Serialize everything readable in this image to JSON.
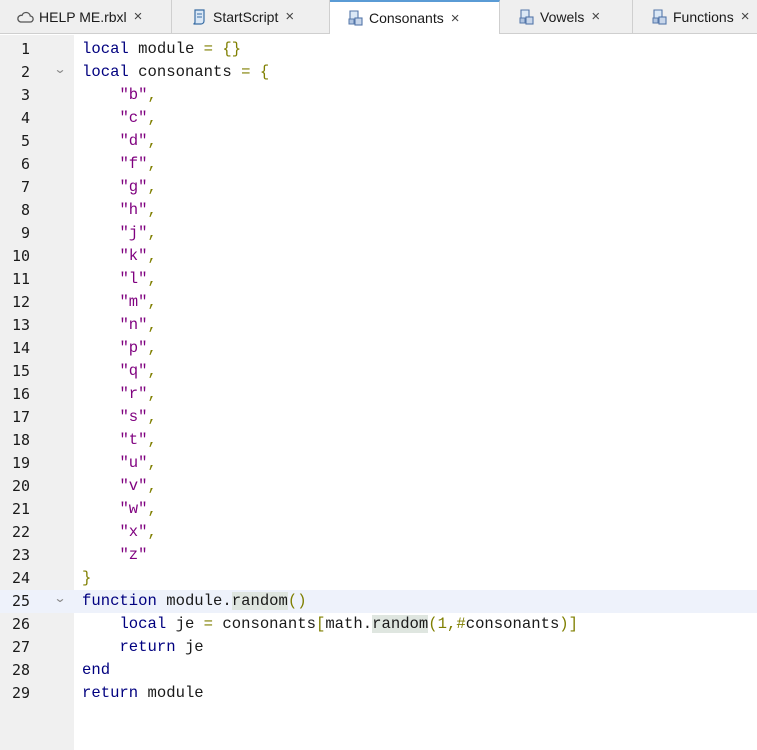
{
  "tabs": [
    {
      "label": "HELP ME.rbxl",
      "icon": "cloud-icon",
      "close": "×",
      "active": false
    },
    {
      "label": "StartScript",
      "icon": "script-icon",
      "close": "×",
      "active": false
    },
    {
      "label": "Consonants",
      "icon": "module-script-icon",
      "close": "×",
      "active": true
    },
    {
      "label": "Vowels",
      "icon": "module-script-icon",
      "close": "×",
      "active": false
    },
    {
      "label": "Functions",
      "icon": "module-script-icon",
      "close": "×",
      "active": false
    }
  ],
  "editor": {
    "current_line": 25,
    "fold_arrow": "⌄",
    "lines": [
      {
        "num": "1",
        "code": "local module = {}"
      },
      {
        "num": "2",
        "code": "local consonants = {",
        "fold": true
      },
      {
        "num": "3",
        "code": "    \"b\","
      },
      {
        "num": "4",
        "code": "    \"c\","
      },
      {
        "num": "5",
        "code": "    \"d\","
      },
      {
        "num": "6",
        "code": "    \"f\","
      },
      {
        "num": "7",
        "code": "    \"g\","
      },
      {
        "num": "8",
        "code": "    \"h\","
      },
      {
        "num": "9",
        "code": "    \"j\","
      },
      {
        "num": "10",
        "code": "    \"k\","
      },
      {
        "num": "11",
        "code": "    \"l\","
      },
      {
        "num": "12",
        "code": "    \"m\","
      },
      {
        "num": "13",
        "code": "    \"n\","
      },
      {
        "num": "14",
        "code": "    \"p\","
      },
      {
        "num": "15",
        "code": "    \"q\","
      },
      {
        "num": "16",
        "code": "    \"r\","
      },
      {
        "num": "17",
        "code": "    \"s\","
      },
      {
        "num": "18",
        "code": "    \"t\","
      },
      {
        "num": "19",
        "code": "    \"u\","
      },
      {
        "num": "20",
        "code": "    \"v\","
      },
      {
        "num": "21",
        "code": "    \"w\","
      },
      {
        "num": "22",
        "code": "    \"x\","
      },
      {
        "num": "23",
        "code": "    \"z\""
      },
      {
        "num": "24",
        "code": "}"
      },
      {
        "num": "25",
        "code": "function module.random()",
        "fold": true
      },
      {
        "num": "26",
        "code": "    local je = consonants[math.random(1,#consonants)]"
      },
      {
        "num": "27",
        "code": "    return je"
      },
      {
        "num": "28",
        "code": "end"
      },
      {
        "num": "29",
        "code": "return module"
      }
    ]
  },
  "colors": {
    "keyword": "#00007f",
    "string": "#7f007f",
    "operator": "#7f7f00",
    "identifier": "#1a1a1a",
    "gutter": "#f0f0f0",
    "current_line": "#eef2fb",
    "active_tab_accent": "#5a9bd5",
    "highlight": "#dfe6e0"
  }
}
